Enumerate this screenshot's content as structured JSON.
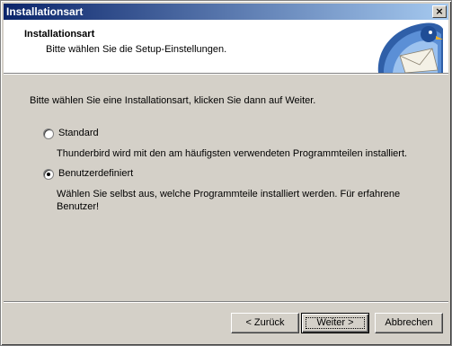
{
  "window": {
    "title": "Installationsart",
    "close_glyph": "×"
  },
  "header": {
    "title": "Installationsart",
    "subtitle": "Bitte wählen Sie die Setup-Einstellungen.",
    "logo_icon": "thunderbird-logo"
  },
  "body": {
    "prompt": "Bitte wählen Sie eine Installationsart, klicken Sie dann auf Weiter.",
    "options": [
      {
        "label": "Standard",
        "description": "Thunderbird wird mit den am häufigsten verwendeten Programmteilen installiert.",
        "selected": false
      },
      {
        "label": "Benutzerdefiniert",
        "description": "Wählen Sie selbst aus, welche Programmteile installiert werden. Für erfahrene Benutzer!",
        "selected": true
      }
    ]
  },
  "buttons": {
    "back": "< Zurück",
    "next": "Weiter >",
    "cancel": "Abbrechen"
  },
  "colors": {
    "titlebar_start": "#0a246a",
    "titlebar_end": "#a6caf0",
    "dialog_bg": "#d4d0c8"
  }
}
